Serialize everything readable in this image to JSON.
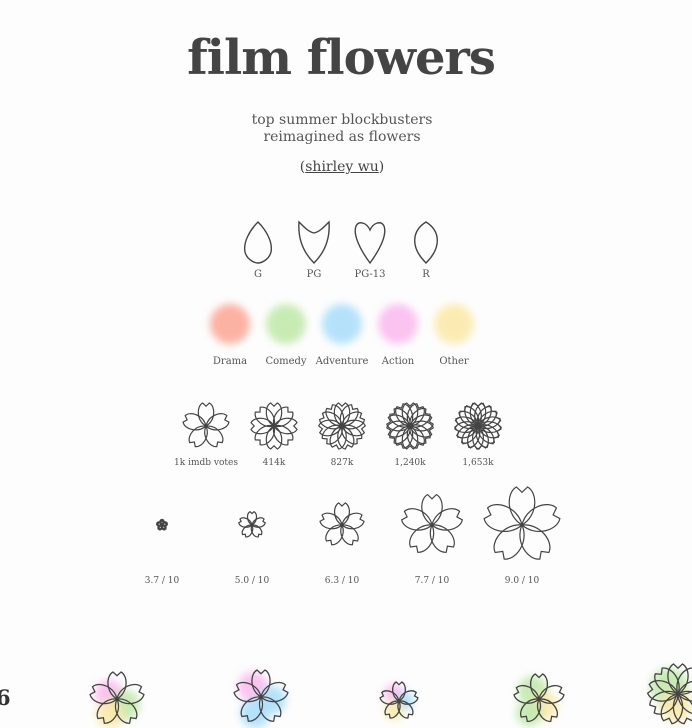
{
  "header": {
    "title": "film flowers",
    "subtitle_line1": "top summer blockbusters",
    "subtitle_line2": "reimagined as flowers",
    "author_open": "(",
    "author_link": "shirley wu",
    "author_close": ")"
  },
  "legend_rating": {
    "items": [
      {
        "label": "G",
        "icon": "petal-teardrop-icon"
      },
      {
        "label": "PG",
        "icon": "petal-notched-icon"
      },
      {
        "label": "PG-13",
        "icon": "petal-heart-icon"
      },
      {
        "label": "R",
        "icon": "petal-leaf-icon"
      }
    ]
  },
  "legend_genre": {
    "items": [
      {
        "label": "Drama",
        "color": "#fca593"
      },
      {
        "label": "Comedy",
        "color": "#bfe8a8"
      },
      {
        "label": "Adventure",
        "color": "#a9ddfb"
      },
      {
        "label": "Action",
        "color": "#fbb9ee"
      },
      {
        "label": "Other",
        "color": "#fbe9a7"
      }
    ]
  },
  "legend_votes": {
    "items": [
      {
        "label": "1k imdb votes",
        "petals": 5
      },
      {
        "label": "414k",
        "petals": 8
      },
      {
        "label": "827k",
        "petals": 11
      },
      {
        "label": "1,240k",
        "petals": 14
      },
      {
        "label": "1,653k",
        "petals": 17
      }
    ]
  },
  "legend_score": {
    "items": [
      {
        "label": "3.7 / 10",
        "size": 0.12
      },
      {
        "label": "5.0 / 10",
        "size": 0.35
      },
      {
        "label": "6.3 / 10",
        "size": 0.58
      },
      {
        "label": "7.7 / 10",
        "size": 0.8
      },
      {
        "label": "9.0 / 10",
        "size": 1.0
      }
    ]
  },
  "bottom_row": {
    "peek_number": "6"
  }
}
